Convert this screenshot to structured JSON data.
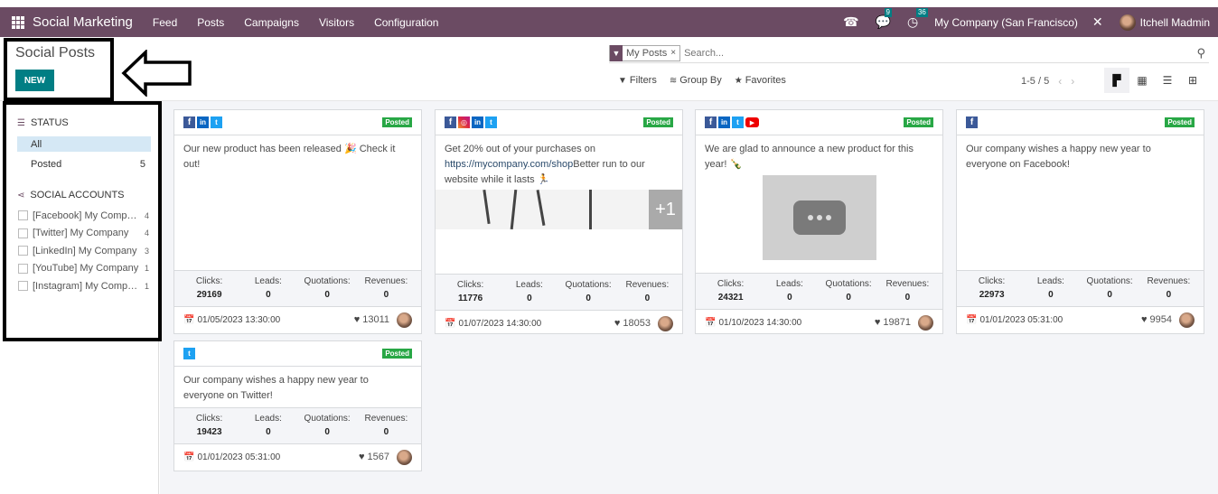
{
  "topbar": {
    "brand": "Social Marketing",
    "menu": [
      "Feed",
      "Posts",
      "Campaigns",
      "Visitors",
      "Configuration"
    ],
    "icons": {
      "phone": "phone-icon",
      "chat": "chat-icon",
      "activity": "clock-icon",
      "tools": "tools-icon"
    },
    "chat_count": "9",
    "activity_count": "36",
    "company": "My Company (San Francisco)",
    "user": "Itchell Madmin"
  },
  "control_panel": {
    "title": "Social Posts",
    "new_label": "NEW",
    "facet_label": "My Posts",
    "facet_remove": "×",
    "search_placeholder": "Search...",
    "filters_label": "Filters",
    "groupby_label": "Group By",
    "favorites_label": "Favorites",
    "pager": "1-5 / 5",
    "views": [
      "kanban",
      "calendar",
      "list",
      "pivot"
    ],
    "active_view": "kanban"
  },
  "sidebar": {
    "status_title": "STATUS",
    "status_items": [
      {
        "label": "All",
        "count": "",
        "active": true
      },
      {
        "label": "Posted",
        "count": "5",
        "active": false
      }
    ],
    "accounts_title": "SOCIAL ACCOUNTS",
    "accounts": [
      {
        "label": "[Facebook] My Company",
        "count": "4"
      },
      {
        "label": "[Twitter] My Company",
        "count": "4"
      },
      {
        "label": "[LinkedIn] My Company",
        "count": "3"
      },
      {
        "label": "[YouTube] My Company",
        "count": "1"
      },
      {
        "label": "[Instagram] My Company",
        "count": "1"
      }
    ]
  },
  "stat_labels": {
    "clicks": "Clicks:",
    "leads": "Leads:",
    "quotations": "Quotations:",
    "revenues": "Revenues:"
  },
  "posts": [
    {
      "networks": [
        "facebook",
        "linkedin",
        "twitter"
      ],
      "status": "Posted",
      "text": "Our new product has been released 🎉 Check it out!",
      "clicks": "29169",
      "leads": "0",
      "quotations": "0",
      "revenues": "0",
      "date": "01/05/2023 13:30:00",
      "likes": "13011"
    },
    {
      "networks": [
        "facebook",
        "instagram",
        "linkedin",
        "twitter"
      ],
      "status": "Posted",
      "text_before": "Get 20% out of your purchases on ",
      "link": "https://mycompany.com/shop",
      "text_after": "Better run to our website while it lasts 🏃",
      "image_extra": "+1",
      "clicks": "11776",
      "leads": "0",
      "quotations": "0",
      "revenues": "0",
      "date": "01/07/2023 14:30:00",
      "likes": "18053"
    },
    {
      "networks": [
        "facebook",
        "linkedin",
        "twitter",
        "youtube"
      ],
      "status": "Posted",
      "text": "We are glad to announce a new product for this year! 🍾",
      "clicks": "24321",
      "leads": "0",
      "quotations": "0",
      "revenues": "0",
      "date": "01/10/2023 14:30:00",
      "likes": "19871"
    },
    {
      "networks": [
        "facebook"
      ],
      "status": "Posted",
      "text": "Our company wishes a happy new year to everyone on Facebook!",
      "clicks": "22973",
      "leads": "0",
      "quotations": "0",
      "revenues": "0",
      "date": "01/01/2023 05:31:00",
      "likes": "9954"
    },
    {
      "networks": [
        "twitter"
      ],
      "status": "Posted",
      "text": "Our company wishes a happy new year to everyone on Twitter!",
      "clicks": "19423",
      "leads": "0",
      "quotations": "0",
      "revenues": "0",
      "date": "01/01/2023 05:31:00",
      "likes": "1567"
    }
  ],
  "colors": {
    "brand": "#6b4b63",
    "primary": "#017e84",
    "posted": "#28a745"
  }
}
